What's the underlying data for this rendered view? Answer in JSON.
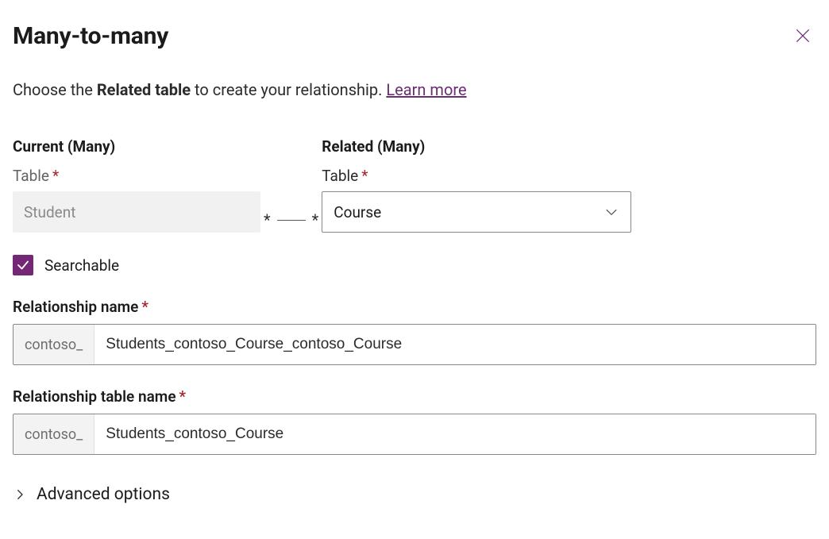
{
  "header": {
    "title": "Many-to-many"
  },
  "intro": {
    "prefix": "Choose the ",
    "bold": "Related table",
    "suffix": " to create your relationship. ",
    "link": "Learn more"
  },
  "current": {
    "heading": "Current (Many)",
    "table_label": "Table",
    "table_value": "Student"
  },
  "related": {
    "heading": "Related (Many)",
    "table_label": "Table",
    "table_value": "Course"
  },
  "connector": {
    "left": "*",
    "right": "*"
  },
  "searchable": {
    "label": "Searchable",
    "checked": true
  },
  "relationship_name": {
    "label": "Relationship name",
    "prefix": "contoso_",
    "value": "Students_contoso_Course_contoso_Course"
  },
  "relationship_table_name": {
    "label": "Relationship table name",
    "prefix": "contoso_",
    "value": "Students_contoso_Course"
  },
  "advanced": {
    "label": "Advanced options"
  },
  "required_marker": "*"
}
